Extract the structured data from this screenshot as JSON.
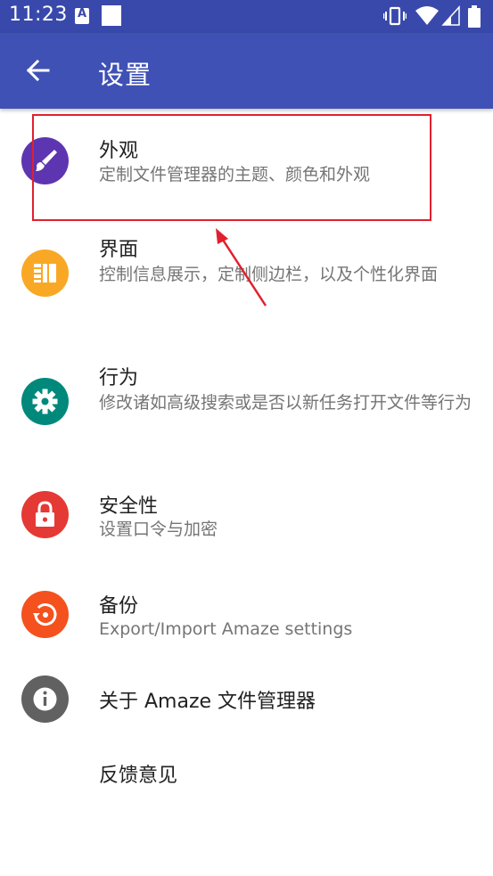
{
  "status_bar": {
    "time": "11:23",
    "notification_icon": "a-icon",
    "icons": [
      "vibrate-icon",
      "wifi-icon",
      "signal-icon",
      "battery-icon"
    ]
  },
  "app_bar": {
    "title": "设置",
    "back_icon": "back-arrow-icon",
    "color": "#3F51B5"
  },
  "settings": [
    {
      "title": "外观",
      "subtitle": "定制文件管理器的主题、颜色和外观",
      "icon": "brush-icon",
      "color": "#5E35B1"
    },
    {
      "title": "界面",
      "subtitle": "控制信息展示，定制侧边栏，以及个性化界面",
      "icon": "view-quilt-icon",
      "color": "#F9A825"
    },
    {
      "title": "行为",
      "subtitle": "修改诸如高级搜索或是否以新任务打开文件等行为",
      "icon": "gear-icon",
      "color": "#00897B"
    },
    {
      "title": "安全性",
      "subtitle": "设置口令与加密",
      "icon": "lock-icon",
      "color": "#E53935"
    },
    {
      "title": "备份",
      "subtitle": "Export/Import Amaze settings",
      "icon": "restore-icon",
      "color": "#F4511E"
    },
    {
      "title": "关于 Amaze 文件管理器",
      "icon": "info-icon",
      "color": "#616161"
    },
    {
      "title": "反馈意见"
    }
  ],
  "annotation": {
    "highlight_color": "#E0202E"
  }
}
